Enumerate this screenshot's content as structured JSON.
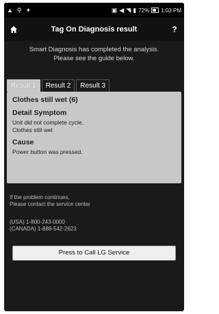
{
  "status_bar": {
    "left_icons": [
      "warning-icon",
      "gps-icon",
      "android-icon"
    ],
    "battery": "72%",
    "time": "1:03 PM"
  },
  "header": {
    "title": "Tag On Diagnosis result",
    "help_label": "?"
  },
  "intro": {
    "line1": "Smart Diagnosis has completed the analysis.",
    "line2": "Please see the guide below."
  },
  "tabs": [
    {
      "label": "Result 1",
      "active": true
    },
    {
      "label": "Result 2",
      "active": false
    },
    {
      "label": "Result 3",
      "active": false
    }
  ],
  "result": {
    "heading": "Clothes still wet (6)",
    "symptom_label": "Detail Symptom",
    "symptom_line1": "Unit did not complete cycle.",
    "symptom_line2": "Clothes still wet",
    "cause_label": "Cause",
    "cause_text": "Power button was pressed."
  },
  "help": {
    "line1": "If the problem continues,",
    "line2": "Please contact the service center"
  },
  "contacts": {
    "usa": "(USA) 1-800-243-0000",
    "canada": "(CANADA) 1-888-542-2623"
  },
  "call_button": {
    "label": "Press to Call LG Service"
  },
  "colors": {
    "background": "#1a1a1a",
    "panel": "#c8c8c8",
    "button": "#efefef"
  }
}
